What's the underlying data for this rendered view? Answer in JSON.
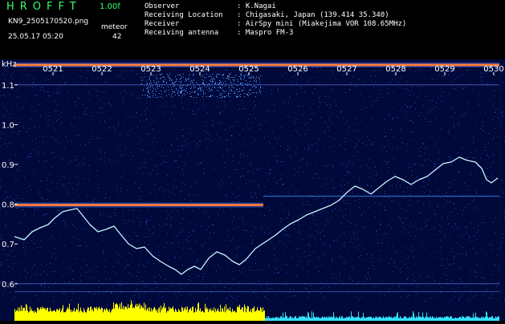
{
  "header": {
    "app_title": "HROFFT",
    "version": "1.00f",
    "filename": "KN9_2505170520.png",
    "meteor_label": "meteor",
    "timestamp": "25.05.17 05:20",
    "meteor_count": "42",
    "info_rows": [
      {
        "label": "Observer",
        "value": ": K.Nagai"
      },
      {
        "label": "Receiving Location",
        "value": ": Chigasaki, Japan (139.414 35.340)"
      },
      {
        "label": "Receiver",
        "value": ": AirSpy mini (Miakejima VOR 108.65MHz)"
      },
      {
        "label": "Receiving antenna",
        "value": ": Maspro FM-3"
      }
    ]
  },
  "spectrogram": {
    "y_unit": "kHz",
    "y_ticks": [
      "1.1",
      "1.0",
      "0.9",
      "0.8",
      "0.7",
      "0.6"
    ],
    "time_ticks": [
      "0521",
      "0522",
      "0523",
      "0524",
      "0525",
      "0526",
      "0527",
      "0528",
      "0529",
      "0530"
    ],
    "colors": {
      "background": "#00093a",
      "noise": "#2a56d8",
      "carrier": "#ff4a2a",
      "trace": "#c9f7ff",
      "bar_yellow": "#ffff00",
      "bar_cyan": "#33e0ff",
      "text": "#ffffff",
      "title": "#39ff6a"
    }
  }
}
